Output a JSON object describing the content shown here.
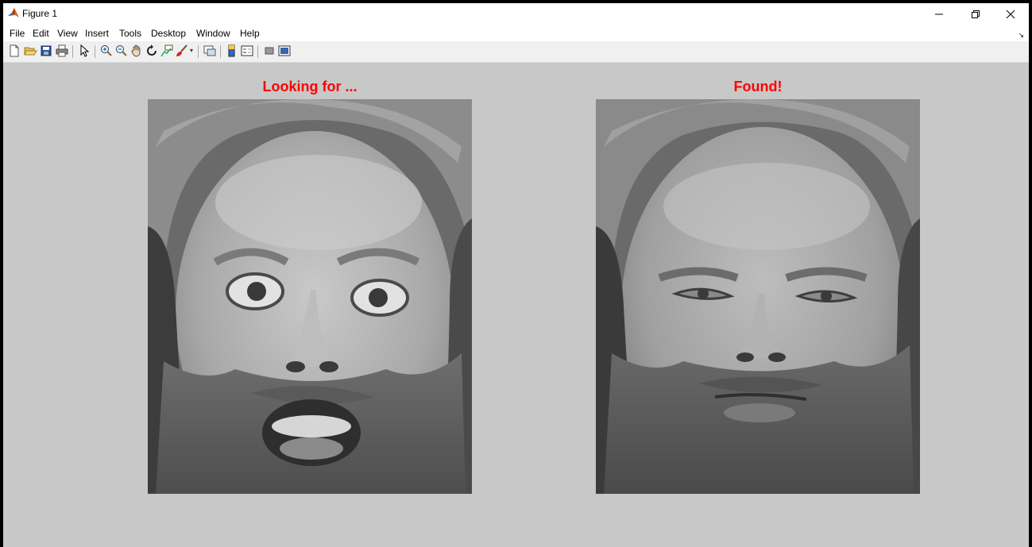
{
  "window": {
    "title": "Figure 1",
    "controls": [
      "minimize",
      "restore",
      "close"
    ]
  },
  "menu": {
    "items": [
      "File",
      "Edit",
      "View",
      "Insert",
      "Tools",
      "Desktop",
      "Window",
      "Help"
    ]
  },
  "toolbar": {
    "buttons": [
      {
        "name": "new-figure",
        "icon": "new-file-icon"
      },
      {
        "name": "open-file",
        "icon": "folder-open-icon"
      },
      {
        "name": "save-figure",
        "icon": "save-icon"
      },
      {
        "name": "print-figure",
        "icon": "printer-icon"
      },
      {
        "name": "edit-plot",
        "icon": "pointer-arrow-icon"
      },
      {
        "name": "zoom-in",
        "icon": "zoom-in-icon"
      },
      {
        "name": "zoom-out",
        "icon": "zoom-out-icon"
      },
      {
        "name": "pan",
        "icon": "hand-icon"
      },
      {
        "name": "rotate-3d",
        "icon": "rotate-3d-icon"
      },
      {
        "name": "data-cursor",
        "icon": "data-cursor-icon"
      },
      {
        "name": "brush",
        "icon": "brush-icon"
      },
      {
        "name": "link-plot",
        "icon": "link-plot-icon"
      },
      {
        "name": "insert-colorbar",
        "icon": "colorbar-icon"
      },
      {
        "name": "insert-legend",
        "icon": "legend-icon"
      },
      {
        "name": "hide-plot-tools",
        "icon": "hide-tools-icon"
      },
      {
        "name": "show-plot-tools",
        "icon": "show-tools-icon"
      }
    ]
  },
  "axes": [
    {
      "title": "Looking for ...",
      "image": "grayscale face photo, surprised expression, mouth open"
    },
    {
      "title": "Found!",
      "image": "grayscale face photo, neutral expression"
    }
  ],
  "colors": {
    "figure_background": "#c8c8c8",
    "title_color": "#ff0000",
    "toolbar_background": "#f0f0f0"
  }
}
